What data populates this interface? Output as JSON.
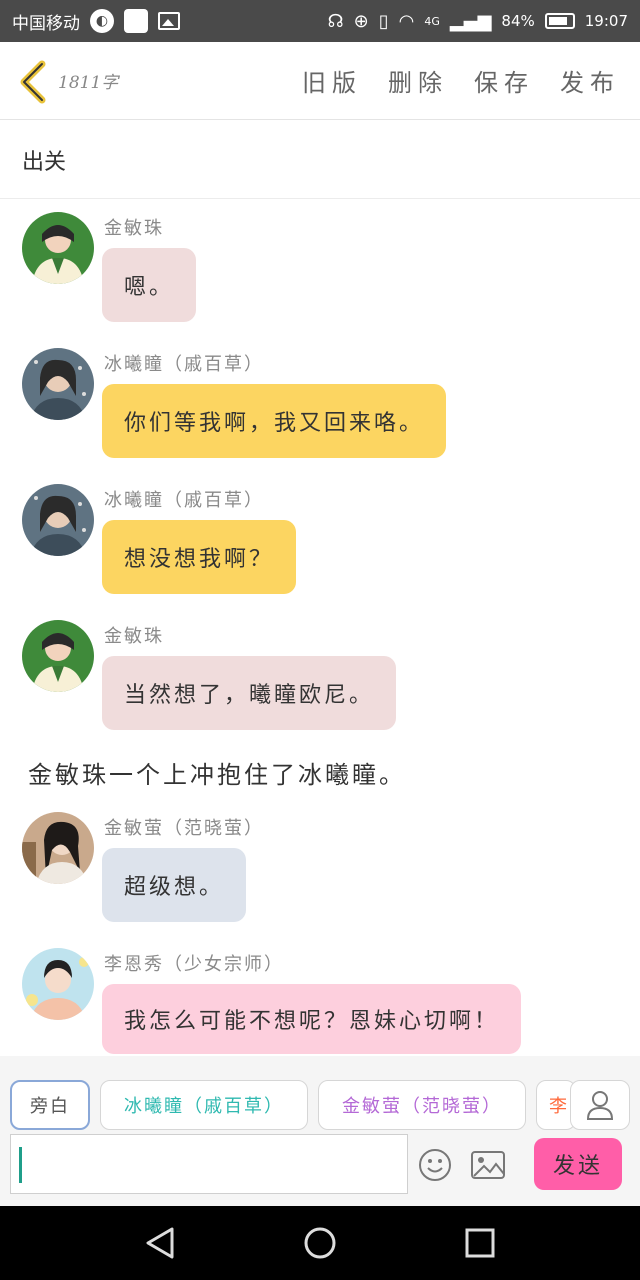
{
  "status": {
    "carrier": "中国移动",
    "network": "4G",
    "battery": "84%",
    "time": "19:07"
  },
  "header": {
    "word_count": "1811字",
    "actions": [
      "旧版",
      "删除",
      "保存",
      "发布"
    ]
  },
  "chapter": {
    "title": "出关"
  },
  "messages": [
    {
      "sender": "金敏珠",
      "text": "嗯。",
      "bubble_color": "#f0dcdc"
    },
    {
      "sender": "冰曦瞳（戚百草）",
      "text": "你们等我啊，我又回来咯。",
      "bubble_color": "#fcd561"
    },
    {
      "sender": "冰曦瞳（戚百草）",
      "text": "想没想我啊？",
      "bubble_color": "#fcd561"
    },
    {
      "sender": "金敏珠",
      "text": "当然想了，曦瞳欧尼。",
      "bubble_color": "#f0dcdc"
    },
    {
      "sender": "金敏萤（范晓萤）",
      "text": "超级想。",
      "bubble_color": "#dde3ec"
    },
    {
      "sender": "李恩秀（少女宗师）",
      "text": "我怎么可能不想呢？恩妹心切啊！",
      "bubble_color": "#fdcfdd"
    }
  ],
  "narration": "金敏珠一个上冲抱住了冰曦瞳。",
  "picker": {
    "chips": [
      {
        "label": "旁白",
        "color": "#555555"
      },
      {
        "label": "冰曦瞳（戚百草）",
        "color": "#2fb9b0"
      },
      {
        "label": "金敏萤（范晓萤）",
        "color": "#b469d6"
      },
      {
        "label": "李",
        "color": "#ff6a3c"
      }
    ],
    "send_label": "发送"
  }
}
